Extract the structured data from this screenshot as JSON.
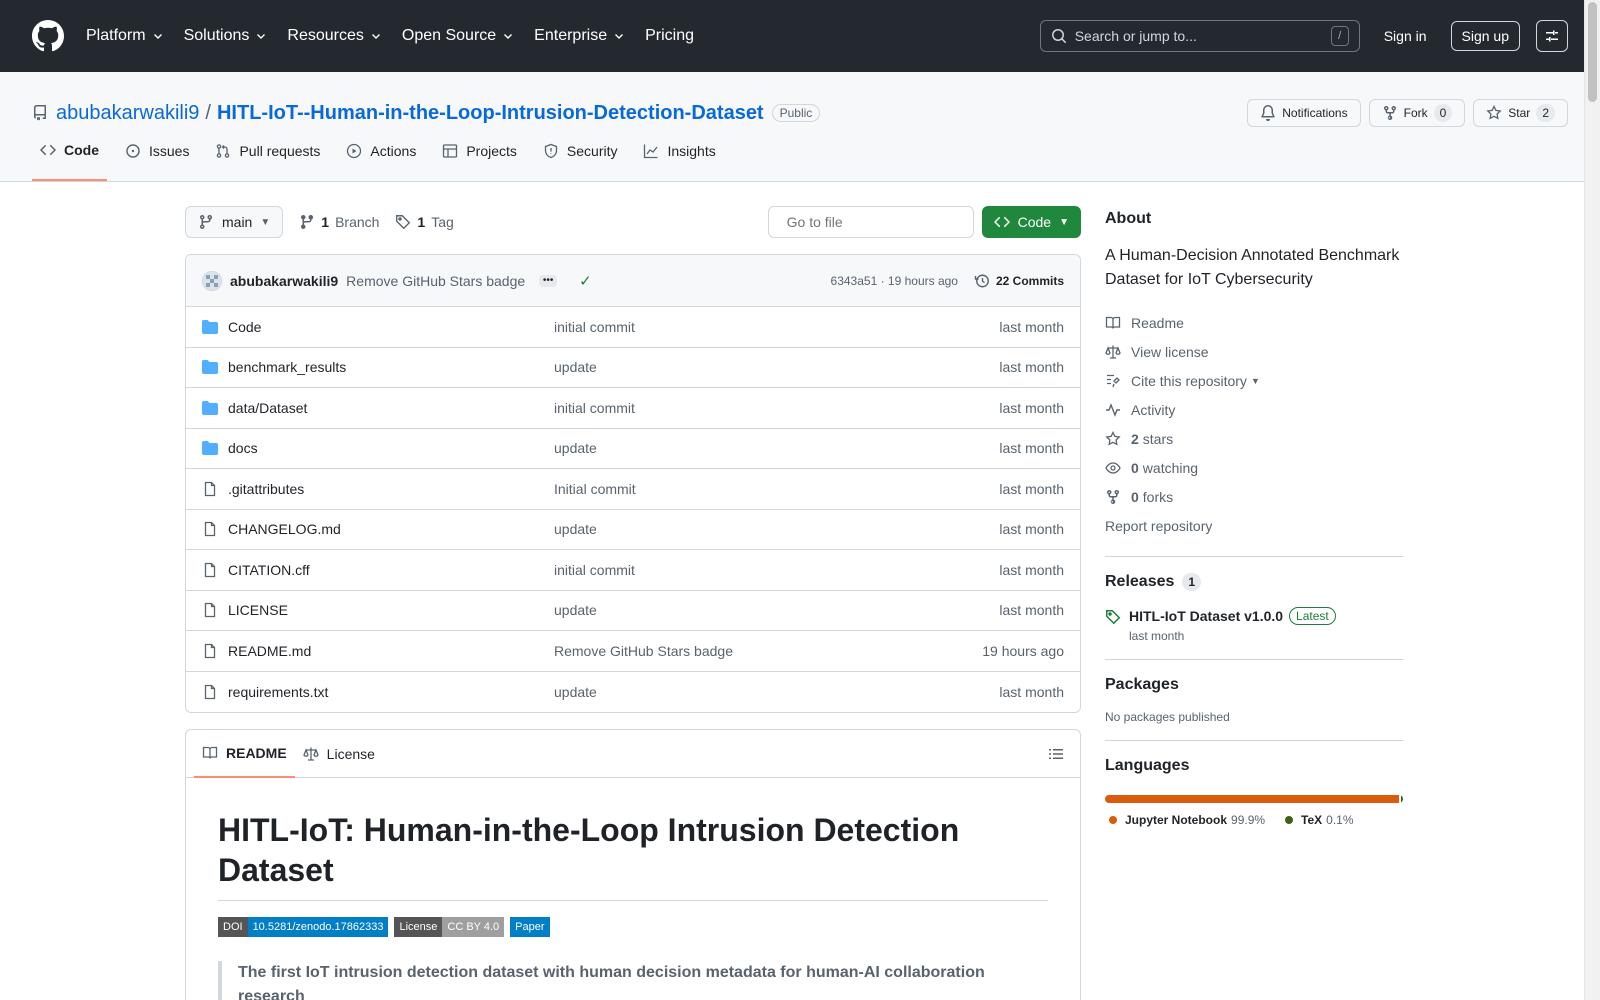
{
  "header": {
    "nav": [
      {
        "label": "Platform",
        "has_menu": true
      },
      {
        "label": "Solutions",
        "has_menu": true
      },
      {
        "label": "Resources",
        "has_menu": true
      },
      {
        "label": "Open Source",
        "has_menu": true
      },
      {
        "label": "Enterprise",
        "has_menu": true
      },
      {
        "label": "Pricing",
        "has_menu": false
      }
    ],
    "search_placeholder": "Search or jump to...",
    "search_key": "/",
    "signin": "Sign in",
    "signup": "Sign up"
  },
  "repo": {
    "owner": "abubakarwakili9",
    "separator": "/",
    "name": "HITL-IoT--Human-in-the-Loop-Intrusion-Detection-Dataset",
    "visibility": "Public",
    "notifications": "Notifications",
    "fork_label": "Fork",
    "fork_count": "0",
    "star_label": "Star",
    "star_count": "2"
  },
  "tabs": [
    {
      "label": "Code",
      "icon": "code-icon",
      "active": true
    },
    {
      "label": "Issues",
      "icon": "issue-icon"
    },
    {
      "label": "Pull requests",
      "icon": "pull-request-icon"
    },
    {
      "label": "Actions",
      "icon": "play-icon"
    },
    {
      "label": "Projects",
      "icon": "table-icon"
    },
    {
      "label": "Security",
      "icon": "shield-icon"
    },
    {
      "label": "Insights",
      "icon": "graph-icon"
    }
  ],
  "file_nav": {
    "branch": "main",
    "branch_count": "1",
    "branch_label": "Branch",
    "tag_count": "1",
    "tag_label": "Tag",
    "goto_placeholder": "Go to file",
    "code_button": "Code"
  },
  "latest_commit": {
    "author": "abubakarwakili9",
    "message": "Remove GitHub Stars badge",
    "ellipsis": "•••",
    "status": "✓",
    "meta": "6343a51 · 19 hours ago",
    "commits": "22 Commits"
  },
  "files": [
    {
      "name": "Code",
      "type": "folder",
      "commit": "initial commit",
      "time": "last month"
    },
    {
      "name": "benchmark_results",
      "type": "folder",
      "commit": "update",
      "time": "last month"
    },
    {
      "name": "data/Dataset",
      "type": "folder",
      "commit": "initial commit",
      "time": "last month"
    },
    {
      "name": "docs",
      "type": "folder",
      "commit": "update",
      "time": "last month"
    },
    {
      "name": ".gitattributes",
      "type": "file",
      "commit": "Initial commit",
      "time": "last month"
    },
    {
      "name": "CHANGELOG.md",
      "type": "file",
      "commit": "update",
      "time": "last month"
    },
    {
      "name": "CITATION.cff",
      "type": "file",
      "commit": "initial commit",
      "time": "last month"
    },
    {
      "name": "LICENSE",
      "type": "file",
      "commit": "update",
      "time": "last month"
    },
    {
      "name": "README.md",
      "type": "file",
      "commit": "Remove GitHub Stars badge",
      "time": "19 hours ago"
    },
    {
      "name": "requirements.txt",
      "type": "file",
      "commit": "update",
      "time": "last month"
    }
  ],
  "readme": {
    "tab_readme": "README",
    "tab_license": "License",
    "title": "HITL-IoT: Human-in-the-Loop Intrusion Detection Dataset",
    "badges": {
      "doi_label": "DOI",
      "doi_value": "10.5281/zenodo.17862333",
      "license_label": "License",
      "license_value": "CC BY 4.0",
      "paper": "Paper"
    },
    "quote": "The first IoT intrusion detection dataset with human decision metadata for human-AI collaboration research"
  },
  "about": {
    "heading": "About",
    "description": "A Human-Decision Annotated Benchmark Dataset for IoT Cybersecurity",
    "readme": "Readme",
    "license": "View license",
    "cite": "Cite this repository",
    "activity": "Activity",
    "stars_count": "2",
    "stars_label": "stars",
    "watching_count": "0",
    "watching_label": "watching",
    "forks_count": "0",
    "forks_label": "forks",
    "report": "Report repository"
  },
  "releases": {
    "heading": "Releases",
    "count": "1",
    "name": "HITL-IoT Dataset v1.0.0",
    "latest": "Latest",
    "time": "last month"
  },
  "packages": {
    "heading": "Packages",
    "empty": "No packages published"
  },
  "languages": {
    "heading": "Languages",
    "items": [
      {
        "name": "Jupyter Notebook",
        "percent": "99.9%",
        "share": 99.9,
        "color": "#DA5B0B"
      },
      {
        "name": "TeX",
        "percent": "0.1%",
        "share": 0.1,
        "color": "#3D6117"
      }
    ]
  }
}
